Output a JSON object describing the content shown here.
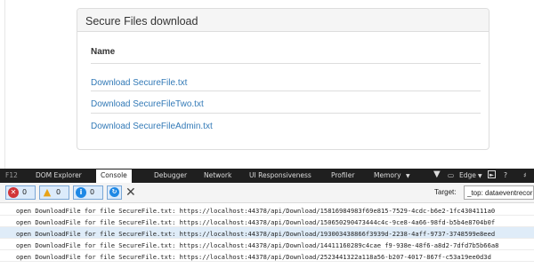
{
  "page": {
    "panel_title": "Secure Files download",
    "table": {
      "column_name": "Name",
      "rows": [
        {
          "link": "Download SecureFile.txt"
        },
        {
          "link": "Download SecureFileTwo.txt"
        },
        {
          "link": "Download SecureFileAdmin.txt"
        }
      ]
    }
  },
  "devtools": {
    "f12_label": "F12",
    "tabs": {
      "dom_explorer": "DOM Explorer",
      "console": "Console",
      "debugger": "Debugger",
      "network": "Network",
      "ui_responsiveness": "UI Responsiveness",
      "profiler": "Profiler",
      "memory": "Memory",
      "emulation_icon": "funnel-icon",
      "device": "Edge",
      "help": "?"
    },
    "filters": {
      "errors": "0",
      "warnings": "0",
      "messages": "0"
    },
    "target_label": "Target:",
    "target_value": "_top: dataeventrecor",
    "log_rows": [
      "open DownloadFile for file SecureFile.txt: https://localhost:44378/api/Download/15816984983f69e815-7529-4cdc-b6e2-1fc4304111a0",
      "open DownloadFile for file SecureFile.txt: https://localhost:44378/api/Download/150650290473444c4c-9ce8-4a66-98fd-b5b4e8704b0f",
      "open DownloadFile for file SecureFile.txt: https://localhost:44378/api/Download/193003438866f3939d-2238-4aff-9737-3748599e8eed",
      "open DownloadFile for file SecureFile.txt: https://localhost:44378/api/Download/14411160289c4cae f9-938e-48f6-a8d2-7dfd7b5b66a8",
      "open DownloadFile for file SecureFile.txt: https://localhost:44378/api/Download/2523441322a118a56-b207-4017-867f-c53a19ee0d3d"
    ],
    "selected_row": 2
  },
  "colors": {
    "link": "#337ab7",
    "menubar": "#1f1f1f",
    "error": "#d13438",
    "info": "#1e88e5",
    "selected_row": "#dfecf8"
  }
}
